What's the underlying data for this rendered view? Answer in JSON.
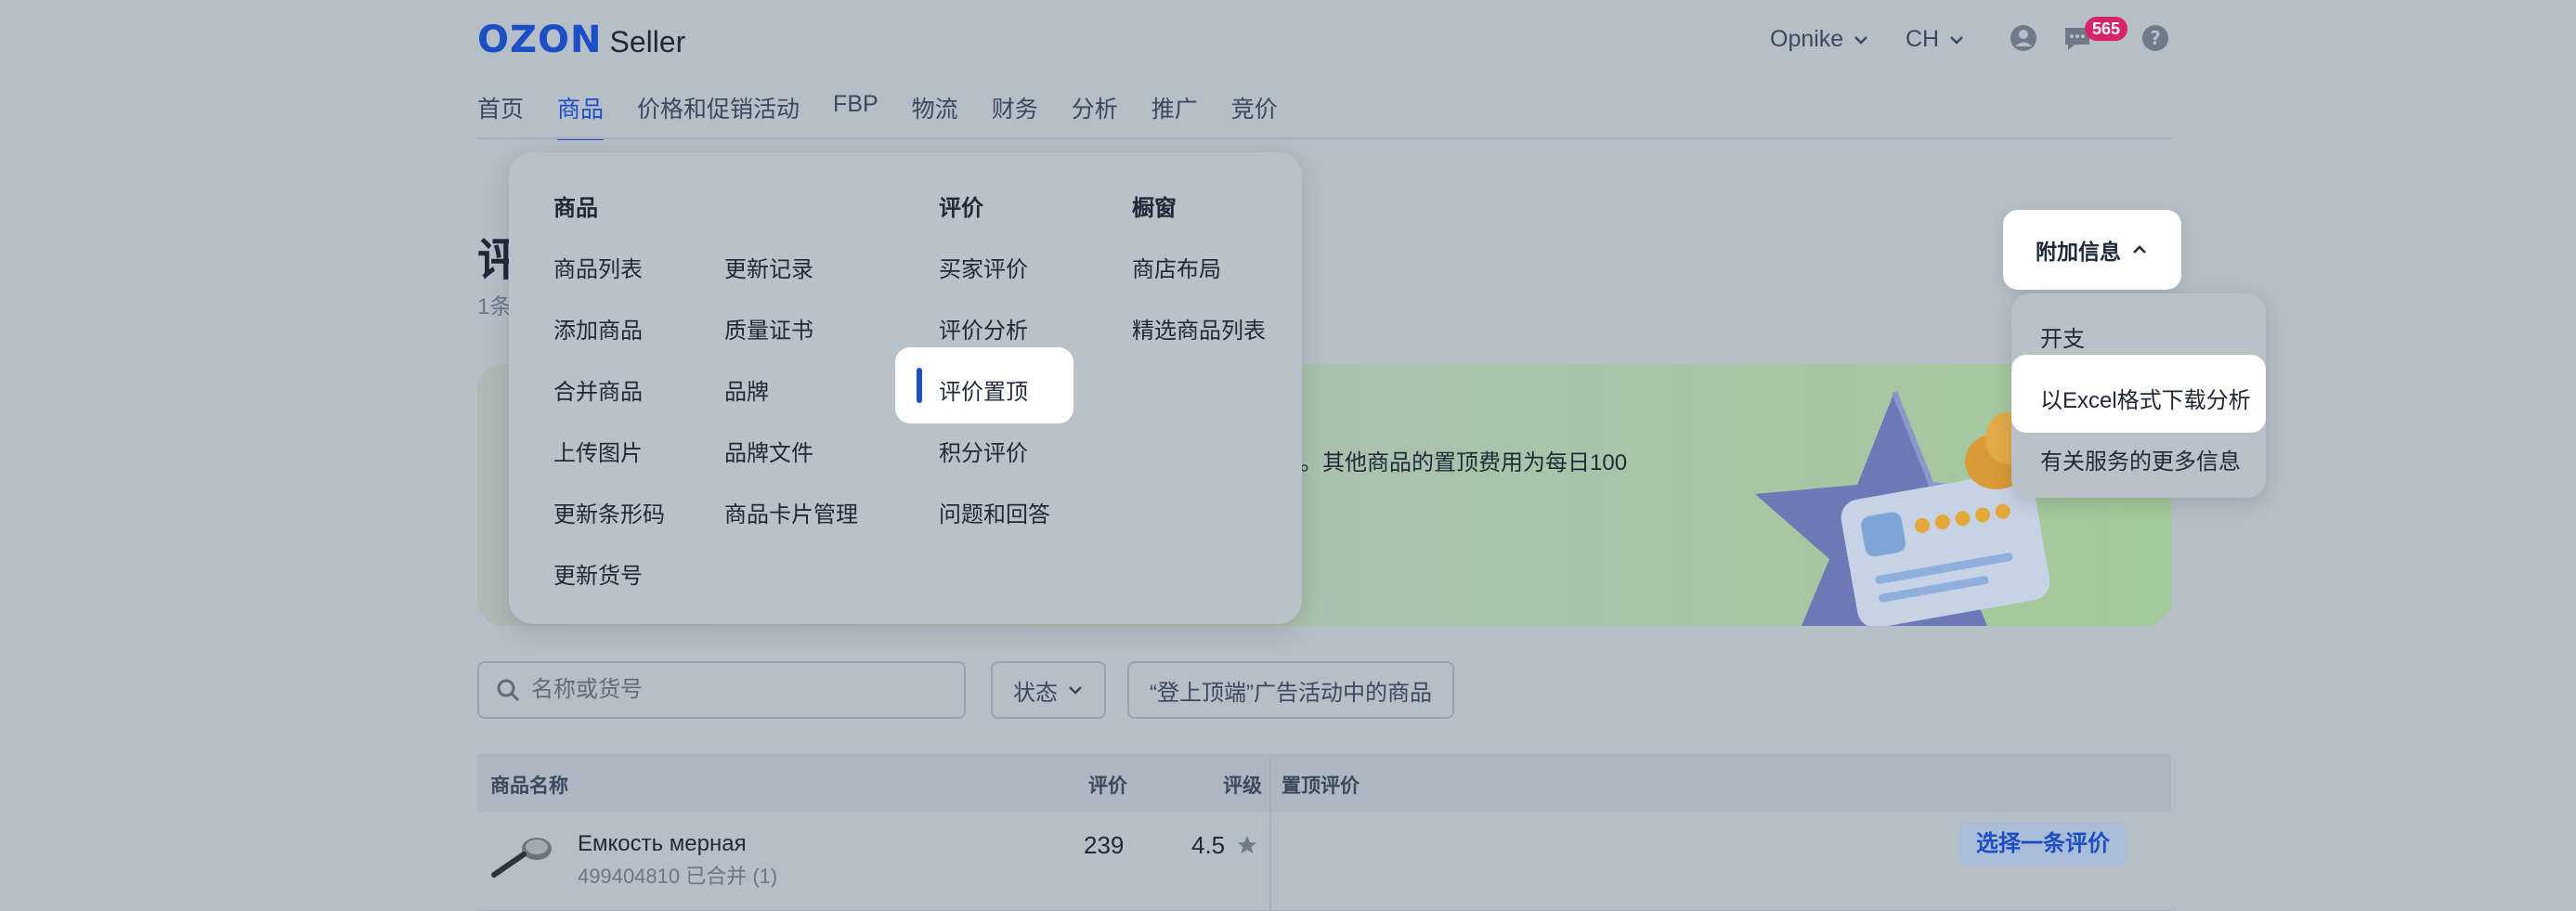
{
  "header": {
    "logo_brand": "OZON",
    "logo_product": "Seller",
    "account": "Opnike",
    "language": "CH",
    "messages_count": "565"
  },
  "nav": {
    "items": [
      "首页",
      "商品",
      "价格和促销活动",
      "FBP",
      "物流",
      "财务",
      "分析",
      "推广",
      "竞价"
    ],
    "active": "商品"
  },
  "page": {
    "title_stub": "评",
    "subtitle_stub": "1条",
    "banner_text": "。其他商品的置顶费用为每日100"
  },
  "mega_menu": {
    "col1_heading": "商品",
    "col1a": [
      "商品列表",
      "添加商品",
      "合并商品",
      "上传图片",
      "更新条形码",
      "更新货号"
    ],
    "col1b": [
      "更新记录",
      "质量证书",
      "品牌",
      "品牌文件",
      "商品卡片管理"
    ],
    "col2_heading": "评价",
    "col2": [
      "买家评价",
      "评价分析",
      "评价置顶",
      "积分评价",
      "问题和回答"
    ],
    "col3_heading": "橱窗",
    "col3": [
      "商店布局",
      "精选商品列表"
    ],
    "selected": "评价置顶"
  },
  "extra": {
    "button_label": "附加信息",
    "items": [
      "开支",
      "以Excel格式下载分析",
      "有关服务的更多信息"
    ],
    "highlighted": "以Excel格式下载分析"
  },
  "filters": {
    "search_placeholder": "名称或货号",
    "status_label": "状态",
    "promo_filter_label": "“登上顶端”广告活动中的商品"
  },
  "table": {
    "headers": [
      "商品名称",
      "评价",
      "评级",
      "置顶评价"
    ],
    "rows": [
      {
        "name": "Емкость мерная",
        "sub": "499404810 已合并 (1)",
        "reviews": "239",
        "rating": "4.5",
        "action": "选择一条评价"
      }
    ]
  },
  "colors": {
    "brand_blue": "#1d4fc4",
    "badge": "#d5246b",
    "overlay_bg": "#b6bec7"
  }
}
